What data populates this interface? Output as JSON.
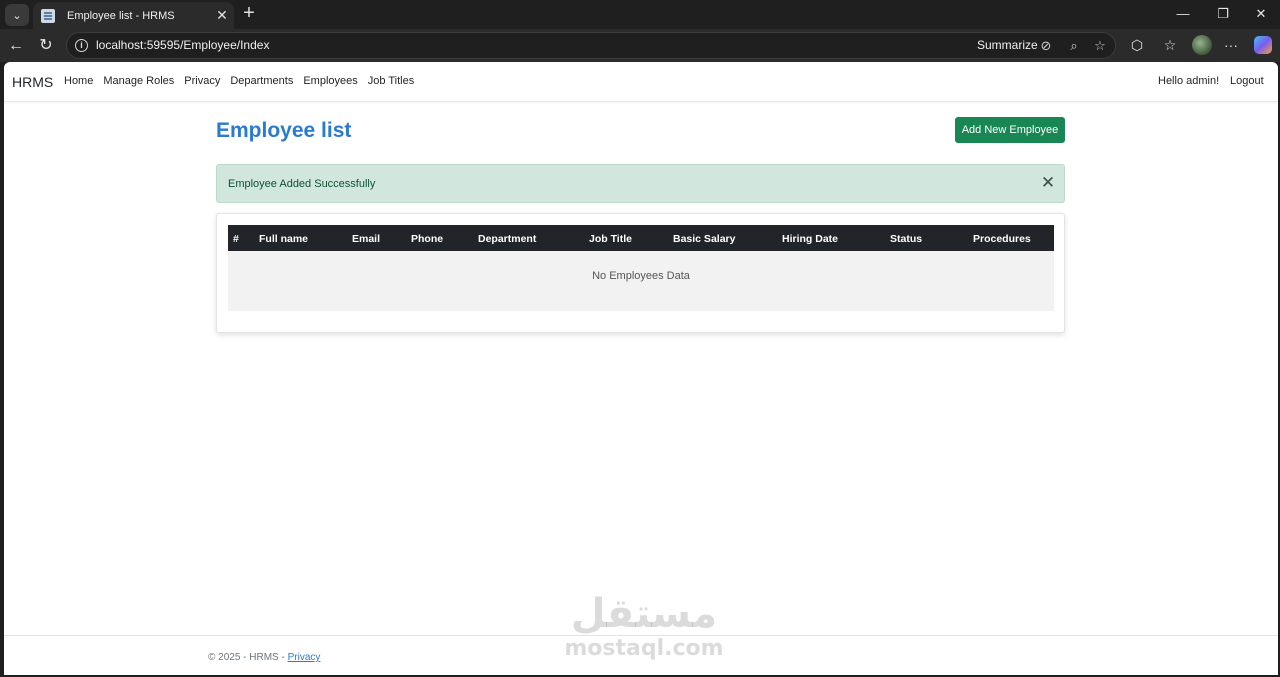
{
  "browser": {
    "tab": {
      "title": "Employee list - HRMS"
    },
    "url": "localhost:59595/Employee/Index",
    "summarize_label": "Summarize"
  },
  "navbar": {
    "brand": "HRMS",
    "links": [
      "Home",
      "Manage Roles",
      "Privacy",
      "Departments",
      "Employees",
      "Job Titles"
    ],
    "greeting": "Hello admin!",
    "logout": "Logout"
  },
  "main": {
    "title": "Employee list",
    "add_button": "Add New Employee",
    "alert": {
      "message": "Employee Added Successfully"
    },
    "table": {
      "columns": [
        "#",
        "Full name",
        "Email",
        "Phone",
        "Department",
        "Job Title",
        "Basic Salary",
        "Hiring Date",
        "Status",
        "Procedures"
      ],
      "empty_message": "No Employees Data"
    }
  },
  "footer": {
    "text": "© 2025 - HRMS - ",
    "privacy_link": "Privacy"
  },
  "watermark": {
    "arabic": "مستقل",
    "latin": "mostaql.com"
  },
  "colors": {
    "brand_link": "#2a7bd0",
    "success": "#198754",
    "alert_bg": "#d1e7dd",
    "table_header": "#212529"
  }
}
